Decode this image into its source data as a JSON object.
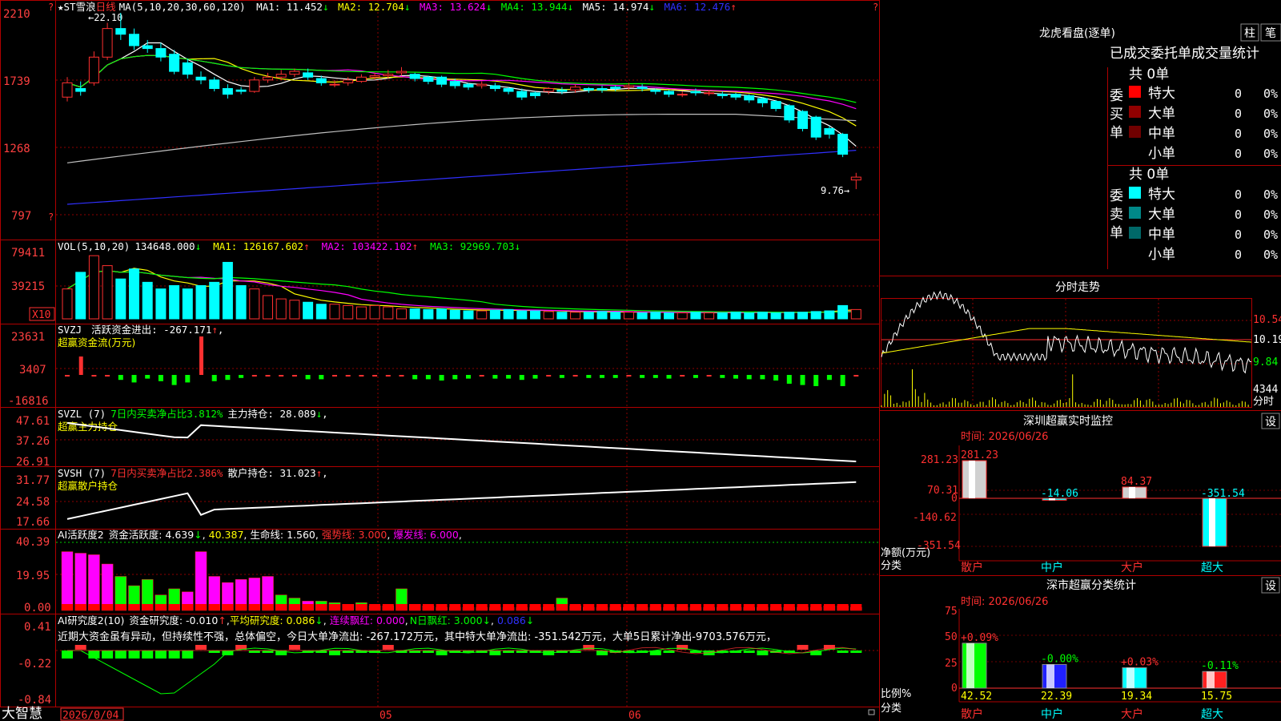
{
  "colors": {
    "up": "#ff3030",
    "down": "#00ffff",
    "grid": "#b00000",
    "ma1": "#ffffff",
    "ma2": "#ffff00",
    "ma3": "#ff00ff",
    "ma4": "#00ff00",
    "ma5": "#c0c0c0",
    "ma6": "#3030ff",
    "green_bar": "#00ff00",
    "magenta": "#ff00ff"
  },
  "price_panel": {
    "title": "★ST雪浪",
    "period": "日线",
    "ma_params": "MA(5,10,20,30,60,120)",
    "indicators": [
      {
        "label": "MA1: 11.452",
        "arrow": "↓"
      },
      {
        "label": "MA2: 12.704",
        "arrow": "↓"
      },
      {
        "label": "MA3: 13.624",
        "arrow": "↓"
      },
      {
        "label": "MA4: 13.944",
        "arrow": "↓"
      },
      {
        "label": "MA5: 14.974",
        "arrow": "↓"
      },
      {
        "label": "MA6: 12.476",
        "arrow": "↑"
      }
    ],
    "y_ticks": [
      "2210",
      "1739",
      "1268",
      "797"
    ],
    "high_marker": "22.10",
    "low_marker": "9.76"
  },
  "volume_panel": {
    "params": "VOL(5,10,20)",
    "value": "134648.000",
    "indicators": [
      {
        "label": "MA1: 126167.602",
        "arrow": "↑"
      },
      {
        "label": "MA2: 103422.102",
        "arrow": "↑"
      },
      {
        "label": "MA3: 92969.703",
        "arrow": "↓"
      }
    ],
    "y_ticks": [
      "79411",
      "39215"
    ],
    "unit": "X10"
  },
  "svzj_panel": {
    "title": "SVZJ",
    "label": "活跃资金进出: -267.171",
    "arrow": "↑",
    "subtitle": "超赢资金流(万元)",
    "y_ticks": [
      "23631",
      "3407",
      "-16816"
    ]
  },
  "svzl_panel": {
    "title": "SVZL (7)",
    "ratio": "7日内买卖净占比3.812%",
    "holding": "主力持仓: 28.089",
    "arrow": "↓",
    "subtitle": "超赢主力持仓",
    "y_ticks": [
      "47.61",
      "37.26",
      "26.91"
    ]
  },
  "svsh_panel": {
    "title": "SVSH (7)",
    "ratio": "7日内买卖净占比2.386%",
    "holding": "散户持仓: 31.023",
    "arrow": "↑",
    "subtitle": "超赢散户持仓",
    "y_ticks": [
      "31.77",
      "24.58",
      "17.66"
    ]
  },
  "ai_activity_panel": {
    "title": "AI活跃度2",
    "label": "资金活跃度: 4.639",
    "arrow": "↓",
    "value2": "40.387",
    "lifeline": "生命线: 1.560",
    "strong": "强势线: 3.000",
    "burst": "爆发线: 6.000",
    "y_ticks": [
      "40.39",
      "19.95",
      "0.00"
    ]
  },
  "ai_research_panel": {
    "title": "AI研究度2(10)",
    "research": "资金研究度: -0.010",
    "avg": "平均研究度: 0.086",
    "consecutive": "连续飘红: 0.000",
    "n_days": "N日飘红: 3.000",
    "last": "0.086",
    "comment": "近期大资金虽有异动，但持续性不强，总体偏空，今日大单净流出: -267.172万元，其中特大单净流出: -351.542万元，大单5日累计净出-9703.576万元，",
    "y_ticks": [
      "0.41",
      "-0.22",
      "-0.84"
    ]
  },
  "bottom_bar": {
    "brand": "大智慧",
    "dates": [
      "2026/0/04",
      "05",
      "06"
    ]
  },
  "dragon_tiger": {
    "title": "龙虎看盘(逐单)",
    "btn_bar": "柱",
    "btn_order": "笔",
    "header": "已成交委托单成交量统计",
    "buy": {
      "side": "委买单",
      "total": "共 0单",
      "rows": [
        {
          "name": "特大",
          "count": "0",
          "pct": "0%",
          "color": "#ff0000"
        },
        {
          "name": "大单",
          "count": "0",
          "pct": "0%",
          "color": "#900000"
        },
        {
          "name": "中单",
          "count": "0",
          "pct": "0%",
          "color": "#700000"
        },
        {
          "name": "小单",
          "count": "0",
          "pct": "0%",
          "color": ""
        }
      ]
    },
    "sell": {
      "side": "委卖单",
      "total": "共 0单",
      "rows": [
        {
          "name": "特大",
          "count": "0",
          "pct": "0%",
          "color": "#00ffff"
        },
        {
          "name": "大单",
          "count": "0",
          "pct": "0%",
          "color": "#008888"
        },
        {
          "name": "中单",
          "count": "0",
          "pct": "0%",
          "color": "#006868"
        },
        {
          "name": "小单",
          "count": "0",
          "pct": "0%",
          "color": ""
        }
      ]
    }
  },
  "intraday": {
    "title": "分时走势",
    "price_ticks": [
      "10.54",
      "10.19",
      "9.84"
    ],
    "vol_tick": "4344",
    "vol_label": "分时"
  },
  "sz_monitor": {
    "title": "深圳超赢实时监控",
    "btn": "设",
    "time": "时间: 2026/06/26",
    "y_ticks": [
      "281.23",
      "70.31",
      "0",
      "-140.62",
      "-351.54"
    ],
    "axis_label": "净额(万元)",
    "cat_label": "分类",
    "bars": [
      {
        "cat": "散户",
        "value": 281.23,
        "label": "281.23"
      },
      {
        "cat": "中户",
        "value": -14.06,
        "label": "-14.06"
      },
      {
        "cat": "大户",
        "value": 84.37,
        "label": "84.37"
      },
      {
        "cat": "超大",
        "value": -351.54,
        "label": "-351.54"
      }
    ]
  },
  "sz_class": {
    "title": "深市超赢分类统计",
    "btn": "设",
    "time": "时间: 2026/06/26",
    "y_ticks": [
      "75",
      "50",
      "25",
      "0"
    ],
    "axis_label": "比例%",
    "cat_label": "分类",
    "bars": [
      {
        "cat": "散户",
        "value": 42.52,
        "label": "42.52",
        "change": "+0.09%",
        "color": "#00ff00"
      },
      {
        "cat": "中户",
        "value": 22.39,
        "label": "22.39",
        "change": "-0.00%",
        "color": "#2020ff"
      },
      {
        "cat": "大户",
        "value": 19.34,
        "label": "19.34",
        "change": "+0.03%",
        "color": "#00ffff"
      },
      {
        "cat": "超大",
        "value": 15.75,
        "label": "15.75",
        "change": "-0.11%",
        "color": "#ff2020"
      }
    ]
  },
  "chart_data": {
    "type": "candlestick",
    "series_note": "daily OHLC (yuan), 60 sessions",
    "open": [
      16.2,
      16.8,
      17.2,
      19.0,
      21.0,
      20.6,
      19.8,
      19.6,
      19.2,
      18.6,
      17.6,
      17.4,
      16.8,
      16.7,
      16.6,
      17.4,
      17.6,
      17.8,
      17.9,
      17.5,
      17.1,
      17.2,
      17.3,
      17.6,
      17.7,
      17.9,
      17.8,
      17.6,
      17.6,
      17.3,
      17.1,
      17.0,
      17.0,
      16.8,
      16.6,
      16.5,
      16.6,
      16.7,
      16.7,
      16.8,
      16.8,
      16.9,
      16.9,
      16.9,
      16.7,
      16.6,
      16.4,
      16.6,
      16.5,
      16.4,
      16.4,
      16.3,
      16.1,
      15.9,
      15.6,
      15.2,
      14.8,
      14.0,
      13.6,
      10.4
    ],
    "close": [
      17.2,
      16.6,
      19.0,
      21.0,
      20.6,
      19.8,
      19.6,
      19.0,
      18.0,
      17.8,
      17.4,
      16.8,
      16.4,
      16.6,
      17.4,
      17.6,
      17.8,
      18.0,
      17.6,
      17.2,
      17.1,
      17.4,
      17.6,
      17.7,
      17.8,
      18.0,
      17.5,
      17.3,
      17.1,
      17.0,
      16.9,
      17.1,
      16.8,
      16.6,
      16.2,
      16.3,
      16.8,
      16.6,
      16.9,
      16.7,
      16.7,
      16.8,
      17.0,
      16.8,
      16.6,
      16.4,
      16.4,
      16.5,
      16.5,
      16.3,
      16.2,
      16.0,
      15.8,
      15.4,
      14.6,
      14.0,
      13.4,
      13.6,
      12.2,
      10.6
    ],
    "high": [
      17.6,
      17.3,
      19.4,
      21.4,
      22.1,
      21.0,
      20.2,
      20.0,
      19.5,
      18.9,
      18.0,
      17.6,
      17.1,
      16.9,
      17.6,
      17.9,
      18.1,
      18.2,
      18.2,
      17.7,
      17.4,
      17.6,
      17.8,
      17.9,
      18.1,
      18.3,
      17.9,
      17.7,
      17.7,
      17.5,
      17.2,
      17.3,
      17.2,
      16.9,
      16.8,
      16.6,
      16.9,
      16.9,
      17.1,
      16.9,
      17.0,
      17.0,
      17.2,
      17.1,
      16.8,
      16.7,
      16.6,
      16.8,
      16.7,
      16.6,
      16.5,
      16.4,
      16.2,
      16.0,
      15.7,
      15.3,
      14.9,
      14.2,
      13.7,
      10.9
    ],
    "low": [
      15.9,
      16.3,
      17.0,
      18.8,
      20.2,
      19.5,
      19.3,
      18.7,
      17.8,
      17.5,
      17.1,
      16.6,
      16.1,
      16.4,
      16.5,
      17.2,
      17.4,
      17.6,
      17.4,
      17.0,
      16.9,
      17.0,
      17.2,
      17.4,
      17.5,
      17.7,
      17.3,
      17.1,
      16.9,
      16.8,
      16.7,
      16.8,
      16.6,
      16.4,
      16.0,
      16.1,
      16.4,
      16.4,
      16.5,
      16.5,
      16.5,
      16.6,
      16.7,
      16.6,
      16.4,
      16.2,
      16.2,
      16.3,
      16.3,
      16.1,
      16.0,
      15.8,
      15.5,
      15.2,
      14.4,
      13.8,
      13.2,
      13.3,
      12.0,
      9.76
    ],
    "volume_index": [
      0.45,
      0.7,
      0.95,
      0.8,
      0.6,
      0.75,
      0.55,
      0.45,
      0.5,
      0.45,
      0.5,
      0.55,
      0.85,
      0.5,
      0.45,
      0.35,
      0.3,
      0.28,
      0.25,
      0.22,
      0.22,
      0.2,
      0.18,
      0.2,
      0.18,
      0.15,
      0.15,
      0.14,
      0.15,
      0.13,
      0.12,
      0.12,
      0.13,
      0.14,
      0.12,
      0.12,
      0.11,
      0.1,
      0.1,
      0.1,
      0.11,
      0.1,
      0.1,
      0.09,
      0.1,
      0.09,
      0.09,
      0.1,
      0.09,
      0.09,
      0.1,
      0.09,
      0.1,
      0.09,
      0.1,
      0.1,
      0.11,
      0.12,
      0.2,
      0.14
    ],
    "y_ticks": [
      22.1,
      17.39,
      12.68,
      7.97
    ],
    "ma_values_last": {
      "MA1": 11.452,
      "MA2": 12.704,
      "MA3": 13.624,
      "MA4": 13.944,
      "MA5": 14.974,
      "MA6": 12.476
    },
    "x_labels": [
      "2026/0/04",
      "05",
      "06"
    ]
  }
}
